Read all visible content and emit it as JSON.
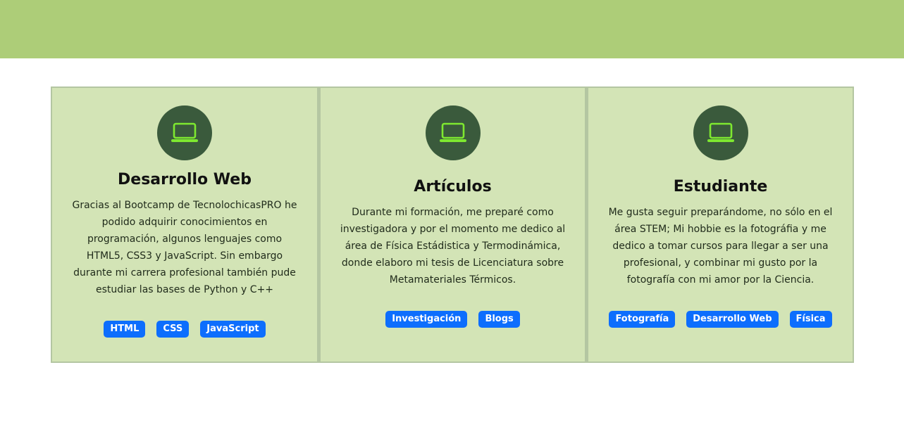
{
  "colors": {
    "banner": "#adcd78",
    "card_bg": "#d3e4b6",
    "card_border": "#b4c6a2",
    "icon_circle": "#3a5a3c",
    "icon_stroke": "#7ee830",
    "tag_bg": "#0d6efd"
  },
  "cards": [
    {
      "icon": "laptop-icon",
      "title": "Desarrollo Web",
      "text": "Gracias al Bootcamp de TecnolochicasPRO he podido adquirir conocimientos en programación, algunos lenguajes como HTML5, CSS3 y JavaScript. Sin embargo durante mi carrera profesional también pude estudiar las bases de Python y C++",
      "tags": [
        "HTML",
        "CSS",
        "JavaScript"
      ]
    },
    {
      "icon": "laptop-icon",
      "title": "Artículos",
      "text": "Durante mi formación, me preparé como investigadora y por el momento me dedico al área de Física Estádistica y Termodinámica, donde elaboro mi tesis de Licenciatura sobre Metamateriales Térmicos.",
      "tags": [
        "Investigación",
        "Blogs"
      ]
    },
    {
      "icon": "laptop-icon",
      "title": "Estudiante",
      "text": "Me gusta seguir preparándome, no sólo en el área STEM; Mi hobbie es la fotográfia y me dedico a tomar cursos para llegar a ser una profesional, y combinar mi gusto por la fotografía con mi amor por la Ciencia.",
      "tags": [
        "Fotografía",
        "Desarrollo Web",
        "Física"
      ]
    }
  ]
}
